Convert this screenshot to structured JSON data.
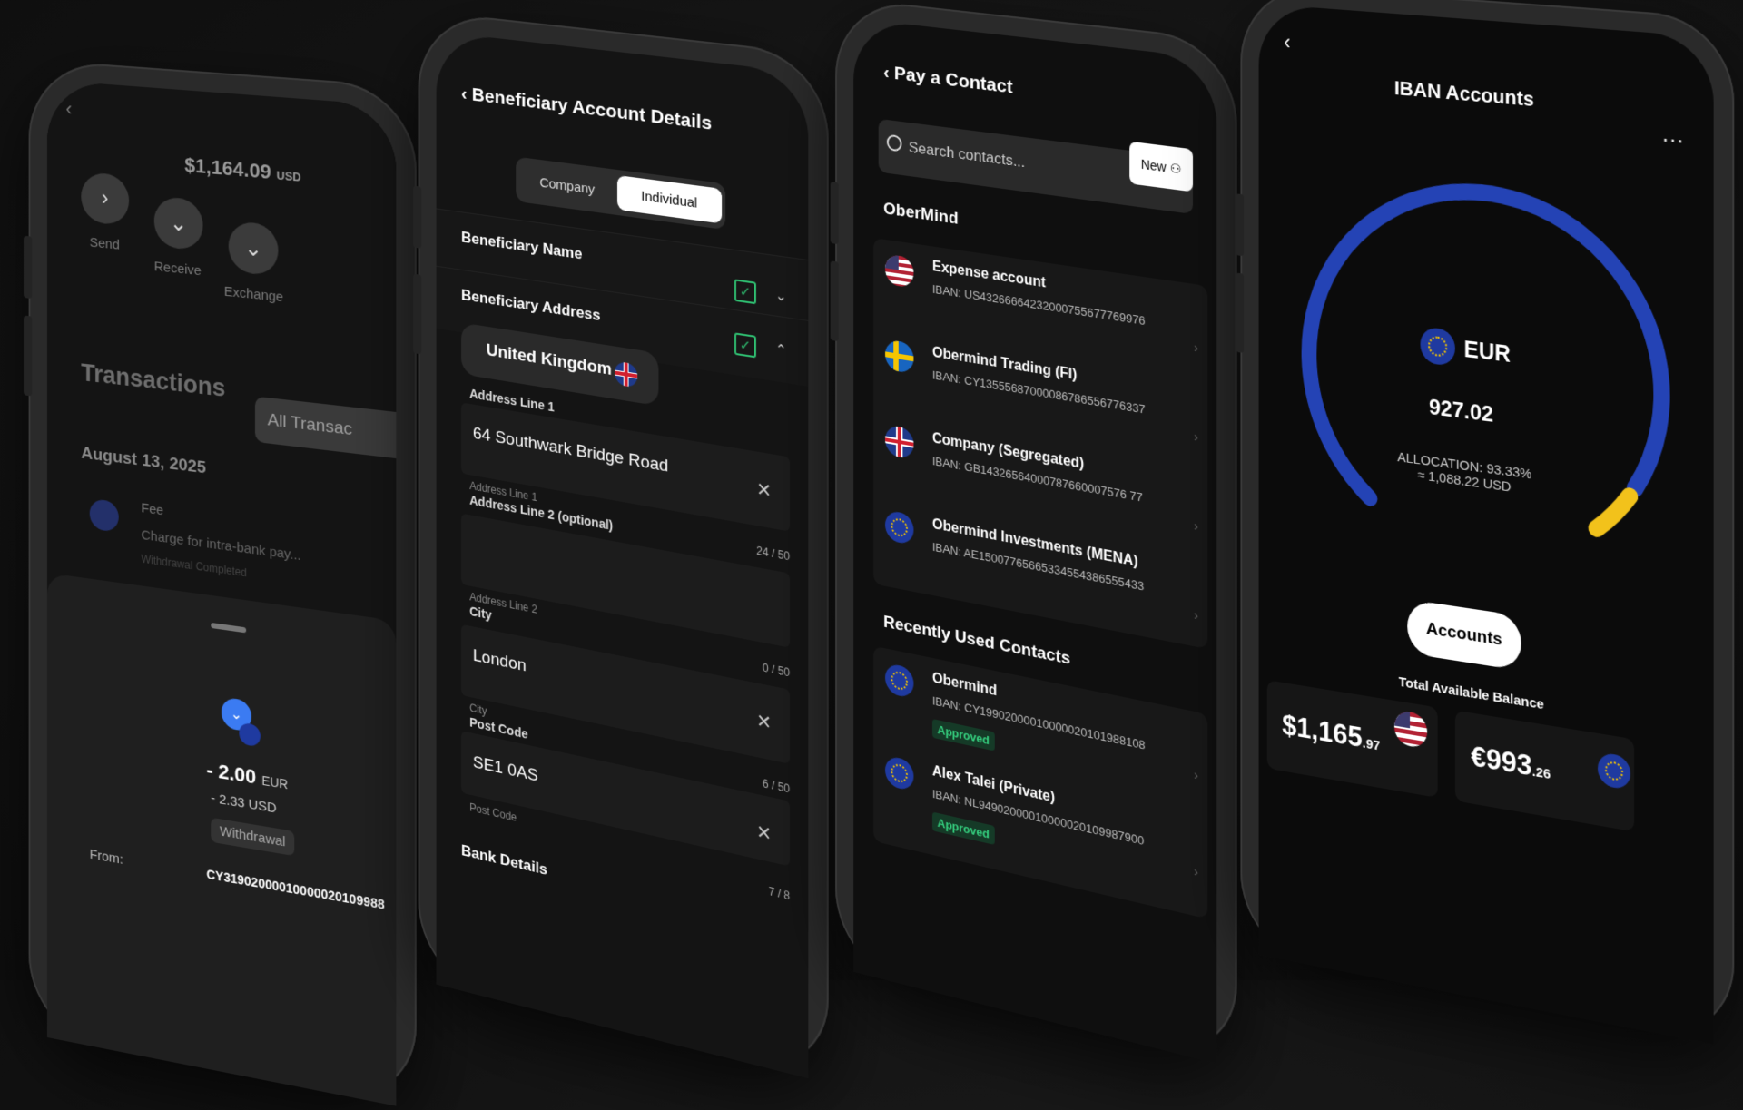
{
  "phone1": {
    "balance": "$1,164.09",
    "balance_currency": "USD",
    "actions": [
      {
        "label": "Send",
        "icon": "chevron-right-icon",
        "glyph": "›"
      },
      {
        "label": "Receive",
        "icon": "chevron-down-icon",
        "glyph": "⌄"
      },
      {
        "label": "Exchange",
        "icon": "chevron-down-icon",
        "glyph": "⌄"
      }
    ],
    "transactions_title": "Transactions",
    "all_transactions": "All Transac",
    "date": "August 13, 2025",
    "fee_label": "Fee",
    "fee_desc": "Charge for intra-bank pay...",
    "fee_tags": "Withdrawal   Completed",
    "detail": {
      "amount": "- 2.00",
      "amount_currency": "EUR",
      "usd": "- 2.33 USD",
      "type": "Withdrawal",
      "from_label": "From:",
      "from_iban": "CY31902000010000020109988"
    }
  },
  "phone2": {
    "header": "Beneficiary Account Details",
    "tabs": {
      "company": "Company",
      "individual": "Individual"
    },
    "beneficiary_name": "Beneficiary Name",
    "beneficiary_address": "Beneficiary Address",
    "country": "United Kingdom",
    "address1": {
      "title": "Address Line 1",
      "value": "64 Southwark Bridge Road",
      "hint": "Address Line 1",
      "count": "24 / 50"
    },
    "address2": {
      "title": "Address Line 2 (optional)",
      "value": "",
      "hint": "Address Line 2",
      "count": "0 / 50"
    },
    "city": {
      "title": "City",
      "value": "London",
      "hint": "City",
      "count": "6 / 50"
    },
    "postcode": {
      "title": "Post Code",
      "value": "SE1 0AS",
      "hint": "Post Code",
      "count": "7 / 8"
    },
    "bank_details": "Bank Details"
  },
  "phone3": {
    "header": "Pay a Contact",
    "search_placeholder": "Search contacts...",
    "new_button": "New",
    "section1": "OberMind",
    "contacts": [
      {
        "name": "Expense account",
        "iban": "IBAN: US43266664232000755677769976",
        "flag": "us"
      },
      {
        "name": "Obermind Trading (FI)",
        "iban": "IBAN: CY13555687000086786556776337",
        "flag": "se"
      },
      {
        "name": "Company (Segregated)",
        "iban": "IBAN: GB14326564000787660007576 77",
        "flag": "uk"
      },
      {
        "name": "Obermind Investments (MENA)",
        "iban": "IBAN: AE15007765665334554386555433",
        "flag": "eu"
      }
    ],
    "section2": "Recently Used Contacts",
    "recent": [
      {
        "name": "Obermind",
        "iban": "IBAN: CY19902000010000020101988108",
        "badge": "Approved"
      },
      {
        "name": "Alex Talei (Private)",
        "iban": "IBAN: NL94902000010000020109987900",
        "badge": "Approved"
      }
    ]
  },
  "phone4": {
    "title": "IBAN Accounts",
    "currency": "EUR",
    "value": "927.02",
    "allocation": "ALLOCATION: 93.33%",
    "approx": "≈ 1,088.22 USD",
    "allocation_fraction": 0.9333,
    "accounts_button": "Accounts",
    "total_label": "Total Available Balance",
    "usd_balance_main": "$1,165",
    "usd_balance_cents": ".97",
    "eur_balance_main": "€993",
    "eur_balance_cents": ".26",
    "colors": {
      "gauge_main": "#2443b5",
      "gauge_accent": "#f2c21b"
    }
  }
}
